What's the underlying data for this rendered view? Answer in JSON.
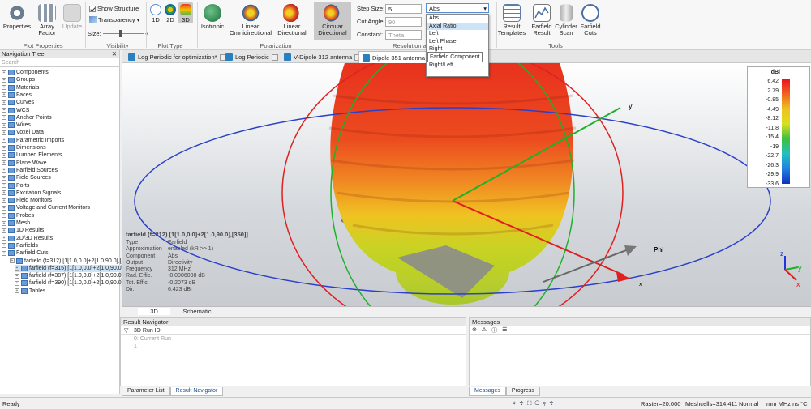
{
  "ribbon": {
    "buttons": [
      {
        "label": "Properties",
        "icon": "gear-icon"
      },
      {
        "label": "Array Factor",
        "icon": "grid-icon"
      },
      {
        "label": "Update",
        "icon": "update-icon"
      },
      {
        "label": "Isotropic",
        "icon": "sphere-icon"
      },
      {
        "label": "Linear Omnidirectional",
        "icon": "omni-icon"
      },
      {
        "label": "Linear Directional",
        "icon": "directional-icon"
      },
      {
        "label": "Circular Directional",
        "icon": "circular-icon"
      },
      {
        "label": "Result Templates",
        "icon": "template-icon"
      },
      {
        "label": "Farfield Result",
        "icon": "farfield-icon"
      },
      {
        "label": "Cylinder Scan",
        "icon": "cylinder-icon"
      },
      {
        "label": "Farfield Cuts",
        "icon": "cuts-icon"
      }
    ],
    "show_structure": "Show Structure",
    "transparency": "Transparency",
    "size": "Size:",
    "plot_type": [
      "1D",
      "2D",
      "3D"
    ],
    "groups": {
      "plot_properties": "Plot Properties",
      "visibility": "Visibility",
      "plot_type": "Plot Type",
      "polarization": "Polarization",
      "resolution": "Resolution a",
      "tools": "Tools"
    },
    "step_size_label": "Step Size:",
    "step_size_value": "5",
    "cut_angle_label": "Cut Angle:",
    "cut_angle_value": "90",
    "constant_label": "Constant:",
    "constant_value": "Theta",
    "component_value": "Abs"
  },
  "dropdown": {
    "options": [
      "Abs",
      "Axial Ratio",
      "Left",
      "Left Phase",
      "Right",
      "Left/Right",
      "Right/Left"
    ],
    "selected": "Axial Ratio",
    "tooltip": "Farfield Component"
  },
  "tabs": [
    {
      "label": "Log Periodic for optimization*"
    },
    {
      "label": "Log Periodic"
    },
    {
      "label": "V-Dipole 312 antenna"
    },
    {
      "label": "Dipole 351 antenna v"
    }
  ],
  "nav": {
    "title": "Navigation Tree",
    "search": "Search",
    "close": "✕",
    "items": [
      "Components",
      "Groups",
      "Materials",
      "Faces",
      "Curves",
      "WCS",
      "Anchor Points",
      "Wires",
      "Voxel Data",
      "Parametric Imports",
      "Dimensions",
      "Lumped Elements",
      "Plane Wave",
      "Farfield Sources",
      "Field Sources",
      "Ports",
      "Excitation Signals",
      "Field Monitors",
      "Voltage and Current Monitors",
      "Probes",
      "Mesh",
      "1D Results",
      "2D/3D Results",
      "Farfields",
      "Farfield Cuts",
      "farfield (f=312) [1[1.0,0.0]+2[1.0,90.0],[3",
      "farfield (f=315) [1[1.0,0.0]+2[1.0,90.0],[3",
      "farfield (f=387) [1[1.0,0.0]+2[1.0,90.0],[3",
      "farfield (f=390) [1[1.0,0.0]+2[1.0,90.0],[3",
      "Tables"
    ]
  },
  "info": {
    "title": "farfield (f=312) [1[1.0,0.0]+2[1.0,90.0],[350]]",
    "rows": [
      [
        "Type",
        "Farfield"
      ],
      [
        "Approximation",
        "enabled (kR >> 1)"
      ],
      [
        "Component",
        "Abs"
      ],
      [
        "Output",
        "Directivity"
      ],
      [
        "Frequency",
        "312 MHz"
      ],
      [
        "Rad. Effic.",
        "-0.0006098 dB"
      ],
      [
        "Tot. Effic.",
        "-0.2073 dB"
      ],
      [
        "Dir.",
        "6.423 dBi"
      ]
    ]
  },
  "legend": {
    "unit": "dBi",
    "ticks": [
      "6.42",
      "2.79",
      "-0.85",
      "-4.49",
      "-8.12",
      "-11.8",
      "-15.4",
      "-19",
      "-22.7",
      "-26.3",
      "-29.9",
      "-33.6"
    ]
  },
  "axes": {
    "x": "x",
    "y": "y",
    "z": "z",
    "phi": "Phi"
  },
  "view_tabs": [
    "3D",
    "Schematic"
  ],
  "result_navigator": {
    "title": "Result Navigator",
    "header": "3D Run ID",
    "rows": [
      "0: Current Run",
      "1"
    ]
  },
  "messages": {
    "title": "Messages"
  },
  "bottom_tabs_left": [
    "Parameter List",
    "Result Navigator"
  ],
  "bottom_tabs_right": [
    "Messages",
    "Progress"
  ],
  "status": {
    "ready": "Ready",
    "raster": "Raster=20.000",
    "meshcells": "Meshcells=314,411",
    "mode": "Normal",
    "units": "mm  MHz  ns  °C"
  }
}
